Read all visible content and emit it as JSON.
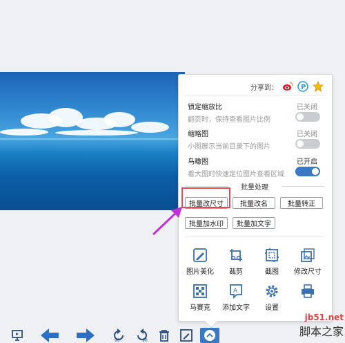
{
  "share": {
    "label": "分享到："
  },
  "settings": [
    {
      "title": "锁定缩放比",
      "state": "已关闭",
      "desc": "翻页时，保持查看图片比例",
      "on": false
    },
    {
      "title": "缩略图",
      "state": "已关闭",
      "desc": "小图展示当前目录下的图片",
      "on": false
    },
    {
      "title": "鸟瞰图",
      "state": "已开启",
      "desc": "看大图时快速定位图片查看区域",
      "on": true
    }
  ],
  "batch": {
    "title": "批量处理",
    "buttons": [
      "批量改尺寸",
      "批量改名",
      "批量转正",
      "批量加水印",
      "批量加文字"
    ]
  },
  "tools": [
    {
      "label": "图片美化",
      "icon": "pen-icon"
    },
    {
      "label": "裁剪",
      "icon": "crop-icon"
    },
    {
      "label": "截图",
      "icon": "screenshot-icon"
    },
    {
      "label": "修改尺寸",
      "icon": "resize-icon"
    },
    {
      "label": "马赛克",
      "icon": "mosaic-icon"
    },
    {
      "label": "添加文字",
      "icon": "add-text-icon"
    },
    {
      "label": "设置",
      "icon": "gear-icon"
    },
    {
      "label": "",
      "icon": "printer-icon"
    }
  ],
  "toolbar": {
    "items": [
      "slideshow-icon",
      "prev-arrow-icon",
      "next-arrow-icon",
      "rotate-left-icon",
      "rotate-right-icon",
      "delete-icon",
      "edit-icon",
      "more-icon"
    ],
    "rotate_left_label": "90",
    "rotate_right_label": "90"
  },
  "watermark": {
    "line1": "jb51.net",
    "line2": "脚本之家"
  },
  "colors": {
    "accent": "#3b78c3",
    "highlight": "#e04b55",
    "arrow": "#c22fd6"
  }
}
